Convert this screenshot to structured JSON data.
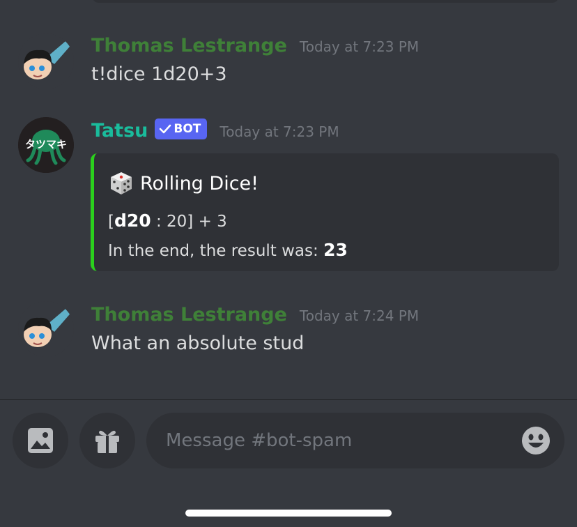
{
  "messages": [
    {
      "author": "Thomas Lestrange",
      "timestamp": "Today at 7:23 PM",
      "text": "t!dice 1d20+3"
    },
    {
      "author": "Tatsu",
      "badge": "BOT",
      "avatar_text": "タツマキ",
      "timestamp": "Today at 7:23 PM",
      "embed": {
        "title": "Rolling Dice!",
        "roll_open": "[",
        "roll_die": "d20",
        "roll_rest": " : 20] + 3",
        "result_label": "In the end, the result was: ",
        "result_value": "23",
        "border_color": "#2bd01d"
      }
    },
    {
      "author": "Thomas Lestrange",
      "timestamp": "Today at 7:24 PM",
      "text": "What an absolute stud"
    }
  ],
  "composer": {
    "placeholder": "Message #bot-spam",
    "attach_icon": "image-icon",
    "gift_icon": "gift-icon",
    "emoji_icon": "emoji-icon"
  },
  "colors": {
    "background": "#36393f",
    "embed_bg": "#2f3136",
    "thomas_name": "#3f8038",
    "tatsu_name": "#1abc9c",
    "bot_badge": "#5865f2"
  }
}
